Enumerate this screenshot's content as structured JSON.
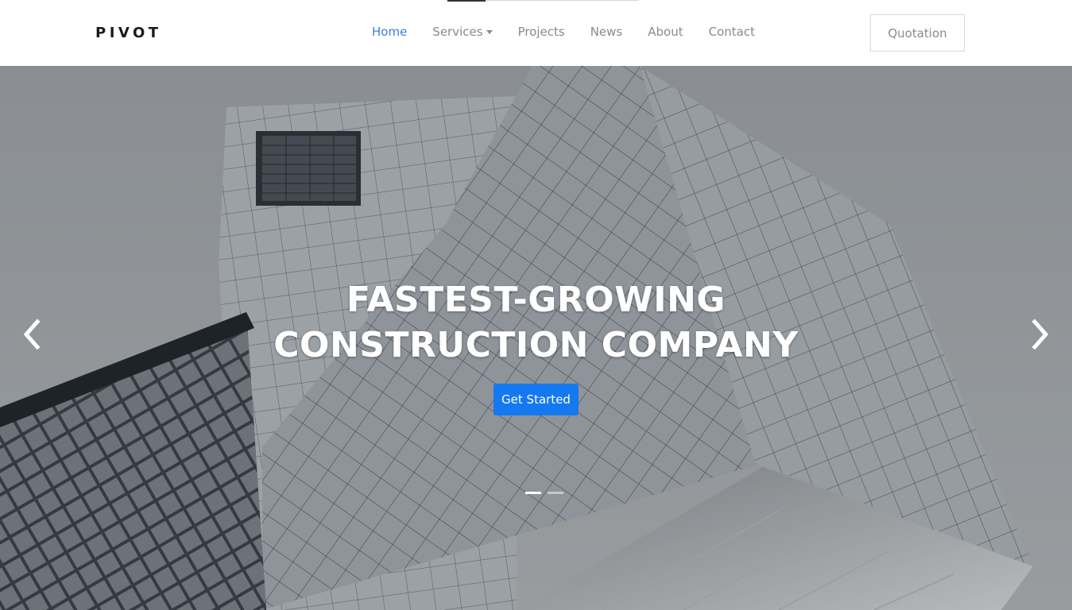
{
  "brand": {
    "logo": "PIVOT"
  },
  "nav": {
    "items": [
      {
        "label": "Home",
        "active": true
      },
      {
        "label": "Services",
        "dropdown": true
      },
      {
        "label": "Projects"
      },
      {
        "label": "News"
      },
      {
        "label": "About"
      },
      {
        "label": "Contact"
      }
    ],
    "quote_label": "Quotation"
  },
  "hero": {
    "headline_line1": "FASTEST-GROWING",
    "headline_line2": "CONSTRUCTION COMPANY",
    "cta_label": "Get Started",
    "slides": 2,
    "active_slide": 1
  },
  "colors": {
    "accent": "#1478f0",
    "nav_active": "#3b7fd9",
    "nav_text": "#8a8a8a"
  },
  "icons": [
    "chevron-left-icon",
    "chevron-right-icon",
    "caret-down-icon"
  ]
}
